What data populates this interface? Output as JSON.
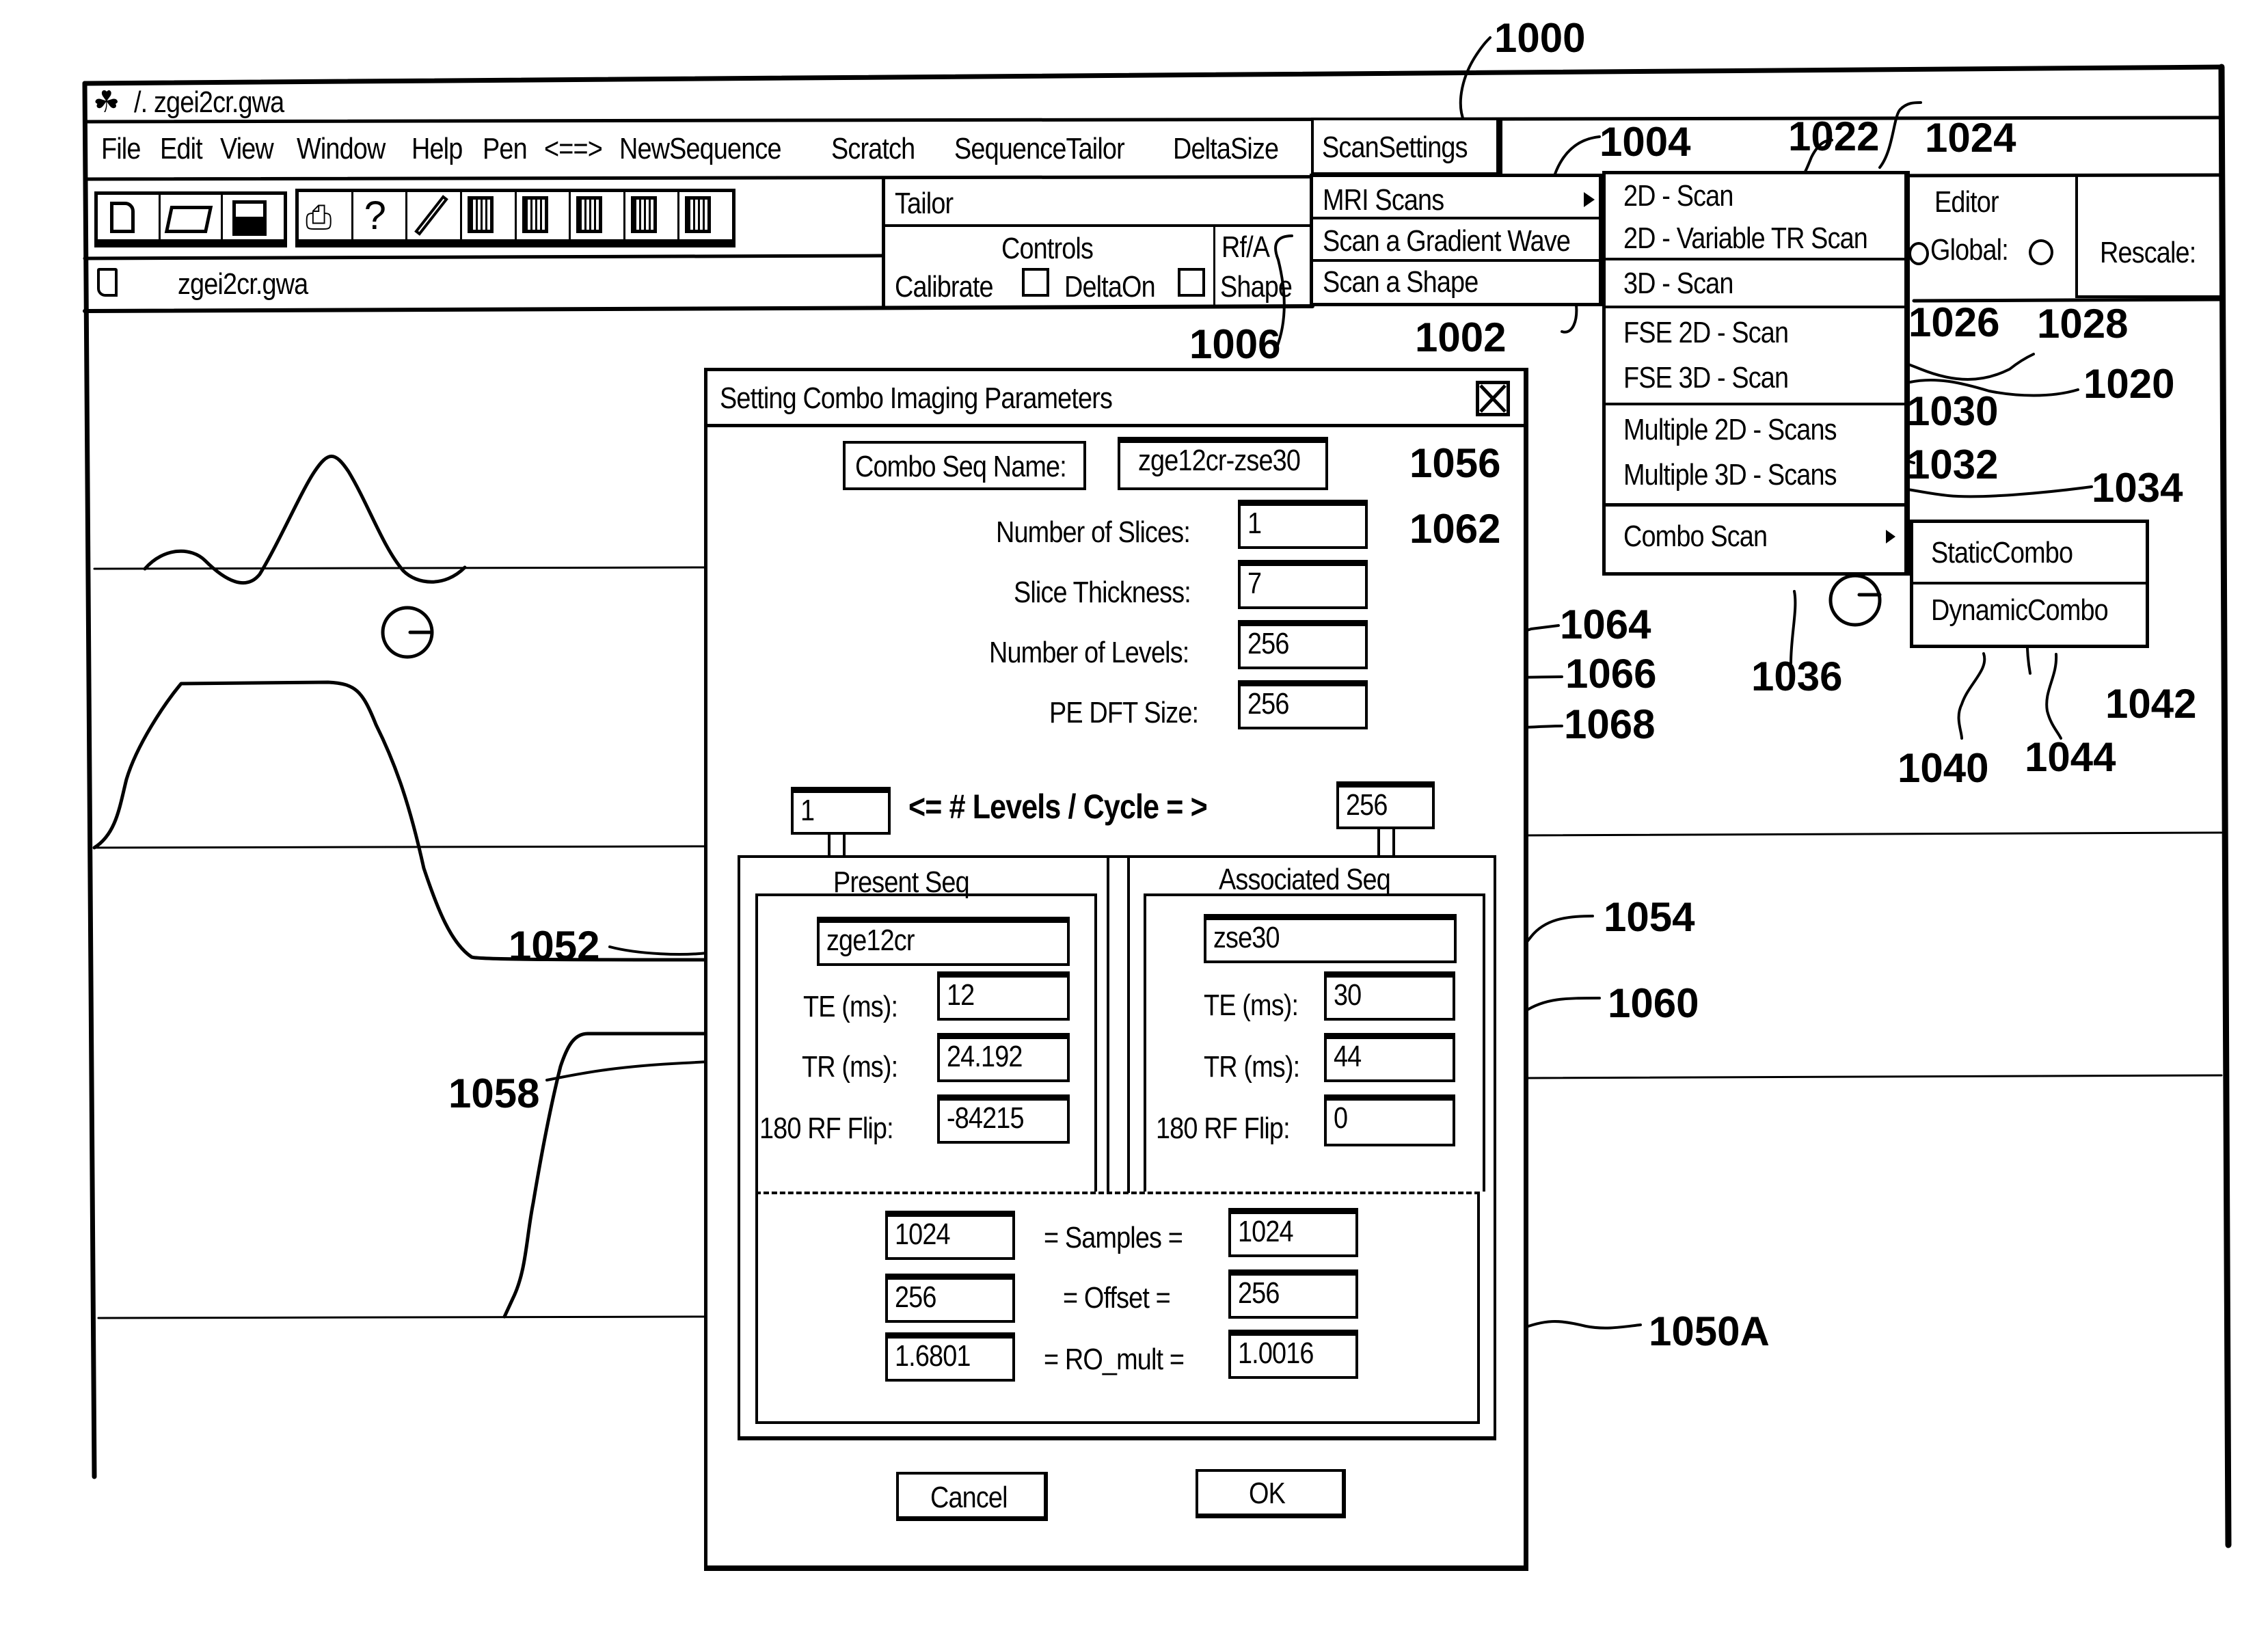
{
  "window": {
    "title": "/. zgei2cr.gwa",
    "doc_name": "zgei2cr.gwa"
  },
  "menubar": {
    "items": [
      "File",
      "Edit",
      "View",
      "Window",
      "Help",
      "Pen",
      "<==>",
      "NewSequence",
      "Scratch",
      "SequenceTailor",
      "DeltaSize"
    ],
    "scan_settings": "ScanSettings"
  },
  "toolbar": {
    "buttons": [
      "new-file",
      "open-folder",
      "save",
      "print",
      "help",
      "pen",
      "pattern-1",
      "pattern-2",
      "pattern-3",
      "pattern-4",
      "pattern-5"
    ],
    "help_glyph": "?"
  },
  "tailor_panel": {
    "title": "Tailor",
    "controls_label": "Controls",
    "calibrate_label": "Calibrate",
    "calibrate_checked": false,
    "deltaon_label": "DeltaOn",
    "deltaon_checked": false,
    "rfa_label": "Rf/A",
    "shape_label": "Shape"
  },
  "scan_menu": {
    "items": [
      {
        "label": "MRI Scans",
        "submenu": true
      },
      {
        "label": "Scan a Gradient Wave"
      },
      {
        "label": "Scan a Shape"
      }
    ]
  },
  "mri_submenu": {
    "items": [
      "2D - Scan",
      "2D - Variable TR Scan",
      "3D - Scan",
      "FSE 2D - Scan",
      "FSE 3D - Scan",
      "Multiple 2D - Scans",
      "Multiple 3D - Scans",
      "Combo Scan"
    ]
  },
  "combo_submenu": {
    "items": [
      "StaticCombo",
      "DynamicCombo"
    ]
  },
  "editor_panel": {
    "title": "Editor",
    "global_label": "Global:",
    "rescale_label": "Rescale:"
  },
  "dialog": {
    "title": "Setting Combo Imaging Parameters",
    "combo_seq_name_label": "Combo Seq Name:",
    "combo_seq_name_value": "zge12cr-zse30",
    "number_of_slices_label": "Number of Slices:",
    "number_of_slices_value": "1",
    "slice_thickness_label": "Slice Thickness:",
    "slice_thickness_value": "7",
    "number_of_levels_label": "Number of Levels:",
    "number_of_levels_value": "256",
    "pe_dft_size_label": "PE DFT Size:",
    "pe_dft_size_value": "256",
    "levels_cycle_left": "1",
    "levels_cycle_label": "<=  # Levels / Cycle  = >",
    "levels_cycle_right": "256",
    "present": {
      "title": "Present Seq",
      "name": "zge12cr",
      "te_label": "TE (ms):",
      "te": "12",
      "tr_label": "TR (ms):",
      "tr": "24.192",
      "flip_label": "180 RF Flip:",
      "flip": "-84215"
    },
    "associated": {
      "title": "Associated Seq",
      "name": "zse30",
      "te_label": "TE (ms):",
      "te": "30",
      "tr_label": "TR (ms):",
      "tr": "44",
      "flip_label": "180 RF Flip:",
      "flip": "0"
    },
    "samples_label": "= Samples =",
    "samples_left": "1024",
    "samples_right": "1024",
    "offset_label": "= Offset =",
    "offset_left": "256",
    "offset_right": "256",
    "ro_mult_label": "= RO_mult =",
    "ro_mult_left": "1.6801",
    "ro_mult_right": "1.0016",
    "cancel_label": "Cancel",
    "ok_label": "OK"
  },
  "reference_numerals": {
    "r1000": "1000",
    "r1002": "1002",
    "r1004": "1004",
    "r1006": "1006",
    "r1020": "1020",
    "r1022": "1022",
    "r1024": "1024",
    "r1026": "1026",
    "r1028": "1028",
    "r1030": "1030",
    "r1032": "1032",
    "r1034": "1034",
    "r1036": "1036",
    "r1040": "1040",
    "r1042": "1042",
    "r1044": "1044",
    "r1050a": "1050A",
    "r1052": "1052",
    "r1054": "1054",
    "r1056": "1056",
    "r1058": "1058",
    "r1060": "1060",
    "r1062": "1062",
    "r1064": "1064",
    "r1066": "1066",
    "r1068": "1068"
  }
}
